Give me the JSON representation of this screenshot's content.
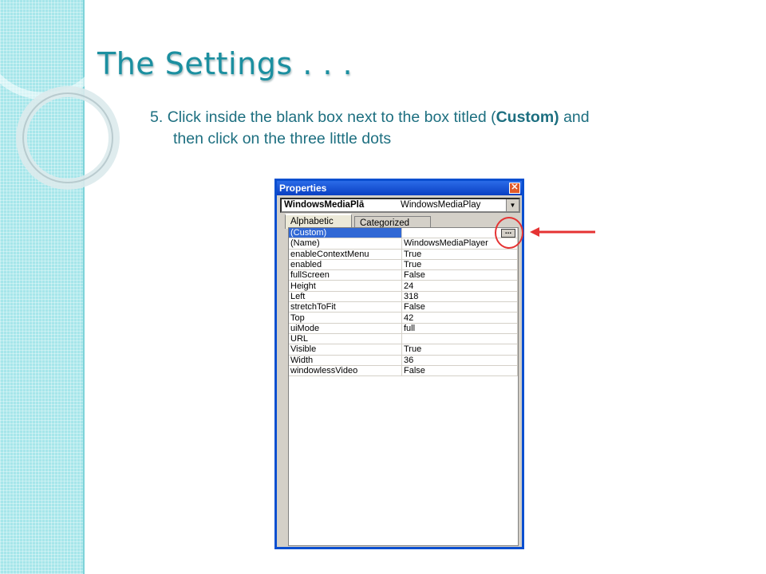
{
  "slide": {
    "title": "The Settings . . .",
    "instruction": {
      "number": "5.",
      "line1_before": "Click inside the blank box next to the box titled (",
      "line1_bold": "Custom)",
      "line1_after": " and",
      "line2": "then click on the three little dots"
    }
  },
  "properties_window": {
    "title": "Properties",
    "close_glyph": "✕",
    "object_name": "WindowsMediaPlā",
    "object_type": "WindowsMediaPlay",
    "dropdown_glyph": "▼",
    "tabs": [
      {
        "label": "Alphabetic",
        "active": true
      },
      {
        "label": "Categorized",
        "active": false
      }
    ],
    "ellipsis_label": "...",
    "properties": [
      {
        "name": "(Custom)",
        "value": ""
      },
      {
        "name": "(Name)",
        "value": "WindowsMediaPlayer"
      },
      {
        "name": "enableContextMenu",
        "value": "True"
      },
      {
        "name": "enabled",
        "value": "True"
      },
      {
        "name": "fullScreen",
        "value": "False"
      },
      {
        "name": "Height",
        "value": "24"
      },
      {
        "name": "Left",
        "value": "318"
      },
      {
        "name": "stretchToFit",
        "value": "False"
      },
      {
        "name": "Top",
        "value": "42"
      },
      {
        "name": "uiMode",
        "value": "full"
      },
      {
        "name": "URL",
        "value": ""
      },
      {
        "name": "Visible",
        "value": "True"
      },
      {
        "name": "Width",
        "value": "36"
      },
      {
        "name": "windowlessVideo",
        "value": "False"
      }
    ]
  },
  "colors": {
    "title": "#1b8fa0",
    "instruction": "#1d6f80",
    "annotation": "#e53333",
    "selection": "#3168d5"
  }
}
